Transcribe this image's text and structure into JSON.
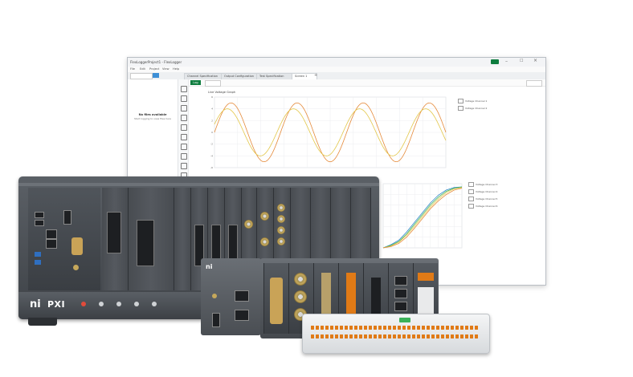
{
  "window": {
    "title": "FlexLoggerProject1 - FlexLogger",
    "menus": [
      "File",
      "Edit",
      "Project",
      "View",
      "Help"
    ],
    "tabs": [
      "Channel Specification",
      "Output Configuration",
      "Test Specification",
      "Screen 1"
    ],
    "left_empty_title": "No files available",
    "left_empty_hint": "Start logging to view files here",
    "logging_button": "Log",
    "chart1_title": "Live Voltage Graph",
    "chart1_legend": [
      "Voltage Channel 1",
      "Voltage Channel 2"
    ],
    "chart2_legend": [
      "Voltage Channel 3",
      "Voltage Channel 4",
      "Voltage Channel 5",
      "Voltage Channel 6"
    ],
    "chart1_y_ticks": [
      "6",
      "4",
      "2",
      "0",
      "-2",
      "-4",
      "-6"
    ],
    "colors": {
      "accent": "#0f7d3f",
      "series_orange": "#e58a3a",
      "series_yellow": "#e3c74a",
      "series_blue": "#2f86c9",
      "series_green": "#3bb25a"
    }
  },
  "hardware": {
    "chassis_brand": "PXI",
    "logo": "ni",
    "cdaq_brand": "ni",
    "controller_brand": "ni"
  },
  "chart_data": [
    {
      "type": "line",
      "title": "Live Voltage Graph",
      "x": [
        0,
        1,
        2,
        3,
        4,
        5,
        6,
        7,
        8,
        9,
        10,
        11,
        12,
        13,
        14
      ],
      "series": [
        {
          "name": "Voltage Channel 1",
          "values": [
            0,
            5,
            0,
            -5,
            0,
            5,
            0,
            -5,
            0,
            5,
            0,
            -5,
            0,
            5,
            0
          ]
        },
        {
          "name": "Voltage Channel 2",
          "values": [
            0,
            4,
            0,
            -4,
            0,
            4,
            0,
            -4,
            0,
            4,
            0,
            -4,
            0,
            4,
            0
          ]
        }
      ],
      "ylim": [
        -6,
        6
      ],
      "grid": true,
      "legend": "right"
    },
    {
      "type": "line",
      "x": [
        0,
        1,
        2,
        3,
        4,
        5,
        6,
        7,
        8,
        9,
        10
      ],
      "series": [
        {
          "name": "Voltage Channel 3",
          "values": [
            0,
            0.5,
            1.2,
            2.5,
            4,
            5.5,
            7,
            8.2,
            9,
            9.4,
            9.5
          ]
        },
        {
          "name": "Voltage Channel 4",
          "values": [
            0,
            0.4,
            1.0,
            2.2,
            3.7,
            5.2,
            6.7,
            7.9,
            8.8,
            9.3,
            9.5
          ]
        },
        {
          "name": "Voltage Channel 5",
          "values": [
            0,
            0.3,
            0.9,
            2.0,
            3.4,
            4.9,
            6.4,
            7.6,
            8.6,
            9.2,
            9.4
          ]
        },
        {
          "name": "Voltage Channel 6",
          "values": [
            0,
            0.2,
            0.7,
            1.7,
            3.1,
            4.6,
            6.1,
            7.3,
            8.3,
            9.0,
            9.3
          ]
        }
      ],
      "ylim": [
        0,
        10
      ],
      "grid": true,
      "legend": "right"
    }
  ]
}
